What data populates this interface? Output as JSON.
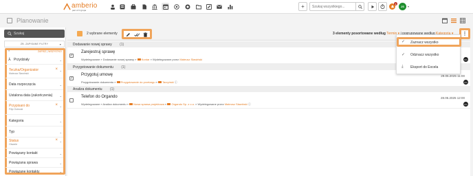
{
  "topbar": {
    "logo_text": "amberio",
    "logo_sub": "part of Ο grupa",
    "search_placeholder": "Szukaj wszystkiego...",
    "user_initials": "JS",
    "notif_count": "1",
    "nav_icons": [
      "contacts-icon",
      "documents-icon",
      "briefcase-icon",
      "file-icon",
      "bank-icon",
      "calendar-icon",
      "chat-icon",
      "settings-icon",
      "folder-icon",
      "edit-icon",
      "mail-icon",
      "bar-chart-icon"
    ]
  },
  "subheader": {
    "title": "Planowanie"
  },
  "sidebar": {
    "search_label": "Szukaj",
    "save_filters_label": "ZB. ZAPISANE FILTRY",
    "save_label": "ZAPISZ",
    "all_label": "WSZYSTKO",
    "filters": [
      {
        "label": "Przydziały",
        "sub": "",
        "active": false
      },
      {
        "label": "Teczka/Organizator",
        "sub": "Mateusz Sławiński",
        "active": true
      },
      {
        "label": "Data rozpoczęcia",
        "sub": "",
        "active": false
      },
      {
        "label": "Ustalona data (zakończenia)",
        "sub": "",
        "active": false
      },
      {
        "label": "Przypisani do",
        "sub": "Filip Ostroski",
        "active": true
      },
      {
        "label": "Kategoria",
        "sub": "",
        "active": false
      },
      {
        "label": "Typ",
        "sub": "",
        "active": false
      },
      {
        "label": "Status",
        "sub": "Otwarte",
        "active": true
      },
      {
        "label": "Powiązany kontakt",
        "sub": "",
        "active": false
      },
      {
        "label": "Powiązana sprawa",
        "sub": "",
        "active": false
      },
      {
        "label": "Powiązane kontakty",
        "sub": "",
        "active": false
      }
    ]
  },
  "toolbar": {
    "selected_label": "2 wybrane elementy",
    "sort_prefix": "3 elementy posortowane według",
    "sort_field": "Termin",
    "group_prefix": "i pogrupowane według",
    "group_field": "Kategoria"
  },
  "list": {
    "groups": [
      {
        "name": "Dodawanie nowej sprawy",
        "count": "(1)",
        "rows": [
          {
            "title": "Zarejestruj sprawę",
            "path_a": "Wydelegowane » Dodawanie nowej sprawy »",
            "path_b": "Kontar",
            "path_c": "» Wydelegowane przez",
            "person": "Mateusz Sławiński",
            "date": "",
            "checked": true,
            "avatar": "FO"
          }
        ]
      },
      {
        "name": "Przygotowanie dokumentu",
        "count": "(1)",
        "rows": [
          {
            "title": "Przygotuj umowę",
            "path_a": "Przygotowanie dokumentu »",
            "path_b": "Przygotowanie do przetargu",
            "path_c": "»",
            "person": "Tarzyński",
            "date": "29.05.2025 11:00",
            "checked": true,
            "avatar": "FO"
          }
        ]
      },
      {
        "name": "Analiza dokumentu",
        "count": "(1)",
        "rows": [
          {
            "title": "Telefon do Orgando",
            "path_a": "Wydelegowane » Analiza dokumentu »",
            "path_b": "Nowa sprawa projektowa",
            "path_c": "» Wydelegowane przez",
            "person": "Mateusz Sławiński",
            "path_d": "Orgando Sp. z o.o.",
            "date": "28.05.2025 12:00",
            "checked": false,
            "avatar": "FO"
          }
        ]
      }
    ]
  },
  "dropdown": {
    "items": [
      {
        "label": "Zaznacz wszystko",
        "icon": "check-all-icon"
      },
      {
        "label": "Odznacz wszystko",
        "icon": "uncheck-all-icon"
      },
      {
        "label": "Eksport do Excela",
        "icon": "download-icon"
      }
    ]
  },
  "colors": {
    "accent": "#e57c23",
    "highlight": "#f0a45a"
  }
}
